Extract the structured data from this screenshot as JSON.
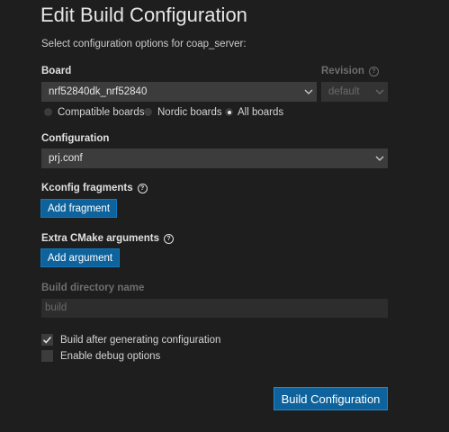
{
  "header": {
    "title": "Edit Build Configuration",
    "subtitle": "Select configuration options for coap_server:"
  },
  "board": {
    "label": "Board",
    "selected": "nrf52840dk_nrf52840",
    "filters": [
      {
        "label": "Compatible boards",
        "checked": false
      },
      {
        "label": "Nordic boards",
        "checked": false
      },
      {
        "label": "All boards",
        "checked": true
      }
    ]
  },
  "revision": {
    "label": "Revision",
    "selected": "default"
  },
  "configuration": {
    "label": "Configuration",
    "selected": "prj.conf"
  },
  "kconfig": {
    "label": "Kconfig fragments",
    "button": "Add fragment"
  },
  "cmake": {
    "label": "Extra CMake arguments",
    "button": "Add argument"
  },
  "build_dir": {
    "label": "Build directory name",
    "placeholder": "build"
  },
  "options": [
    {
      "label": "Build after generating configuration",
      "checked": true
    },
    {
      "label": "Enable debug options",
      "checked": false
    }
  ],
  "footer": {
    "submit": "Build Configuration"
  },
  "icons": {
    "help": "help-circle-icon",
    "chevron": "chevron-down-icon",
    "check": "check-icon"
  }
}
